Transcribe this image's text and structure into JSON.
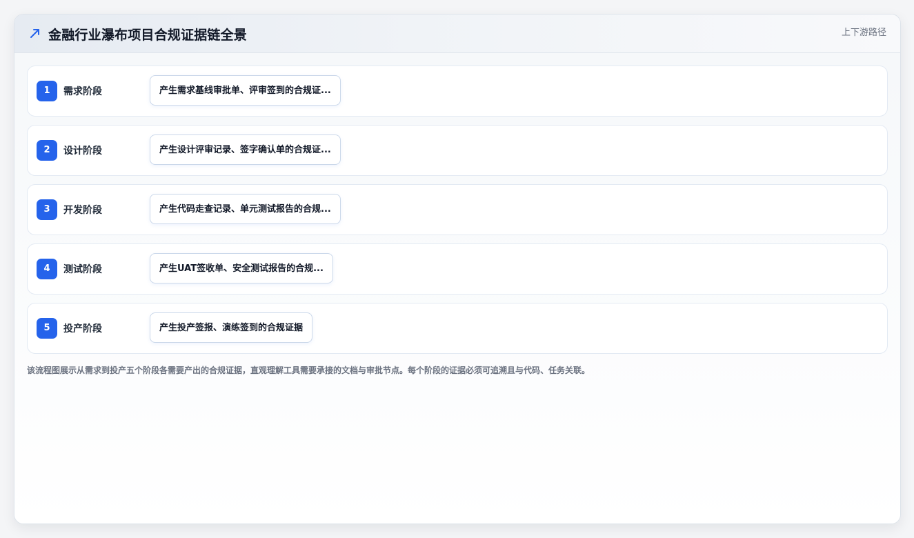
{
  "header": {
    "title": "金融行业瀑布项目合规证据链全景",
    "link": "上下游路径",
    "icon": "trend-arrow-icon",
    "accent": "#2563eb"
  },
  "stages": [
    {
      "num": "1",
      "label": "需求阶段",
      "evidence": "产生需求基线审批单、评审签到的合规证..."
    },
    {
      "num": "2",
      "label": "设计阶段",
      "evidence": "产生设计评审记录、签字确认单的合规证..."
    },
    {
      "num": "3",
      "label": "开发阶段",
      "evidence": "产生代码走查记录、单元测试报告的合规..."
    },
    {
      "num": "4",
      "label": "测试阶段",
      "evidence": "产生UAT签收单、安全测试报告的合规..."
    },
    {
      "num": "5",
      "label": "投产阶段",
      "evidence": "产生投产签报、演练签到的合规证据"
    }
  ],
  "caption": "该流程图展示从需求到投产五个阶段各需要产出的合规证据，直观理解工具需要承接的文档与审批节点。每个阶段的证据必须可追溯且与代码、任务关联。"
}
